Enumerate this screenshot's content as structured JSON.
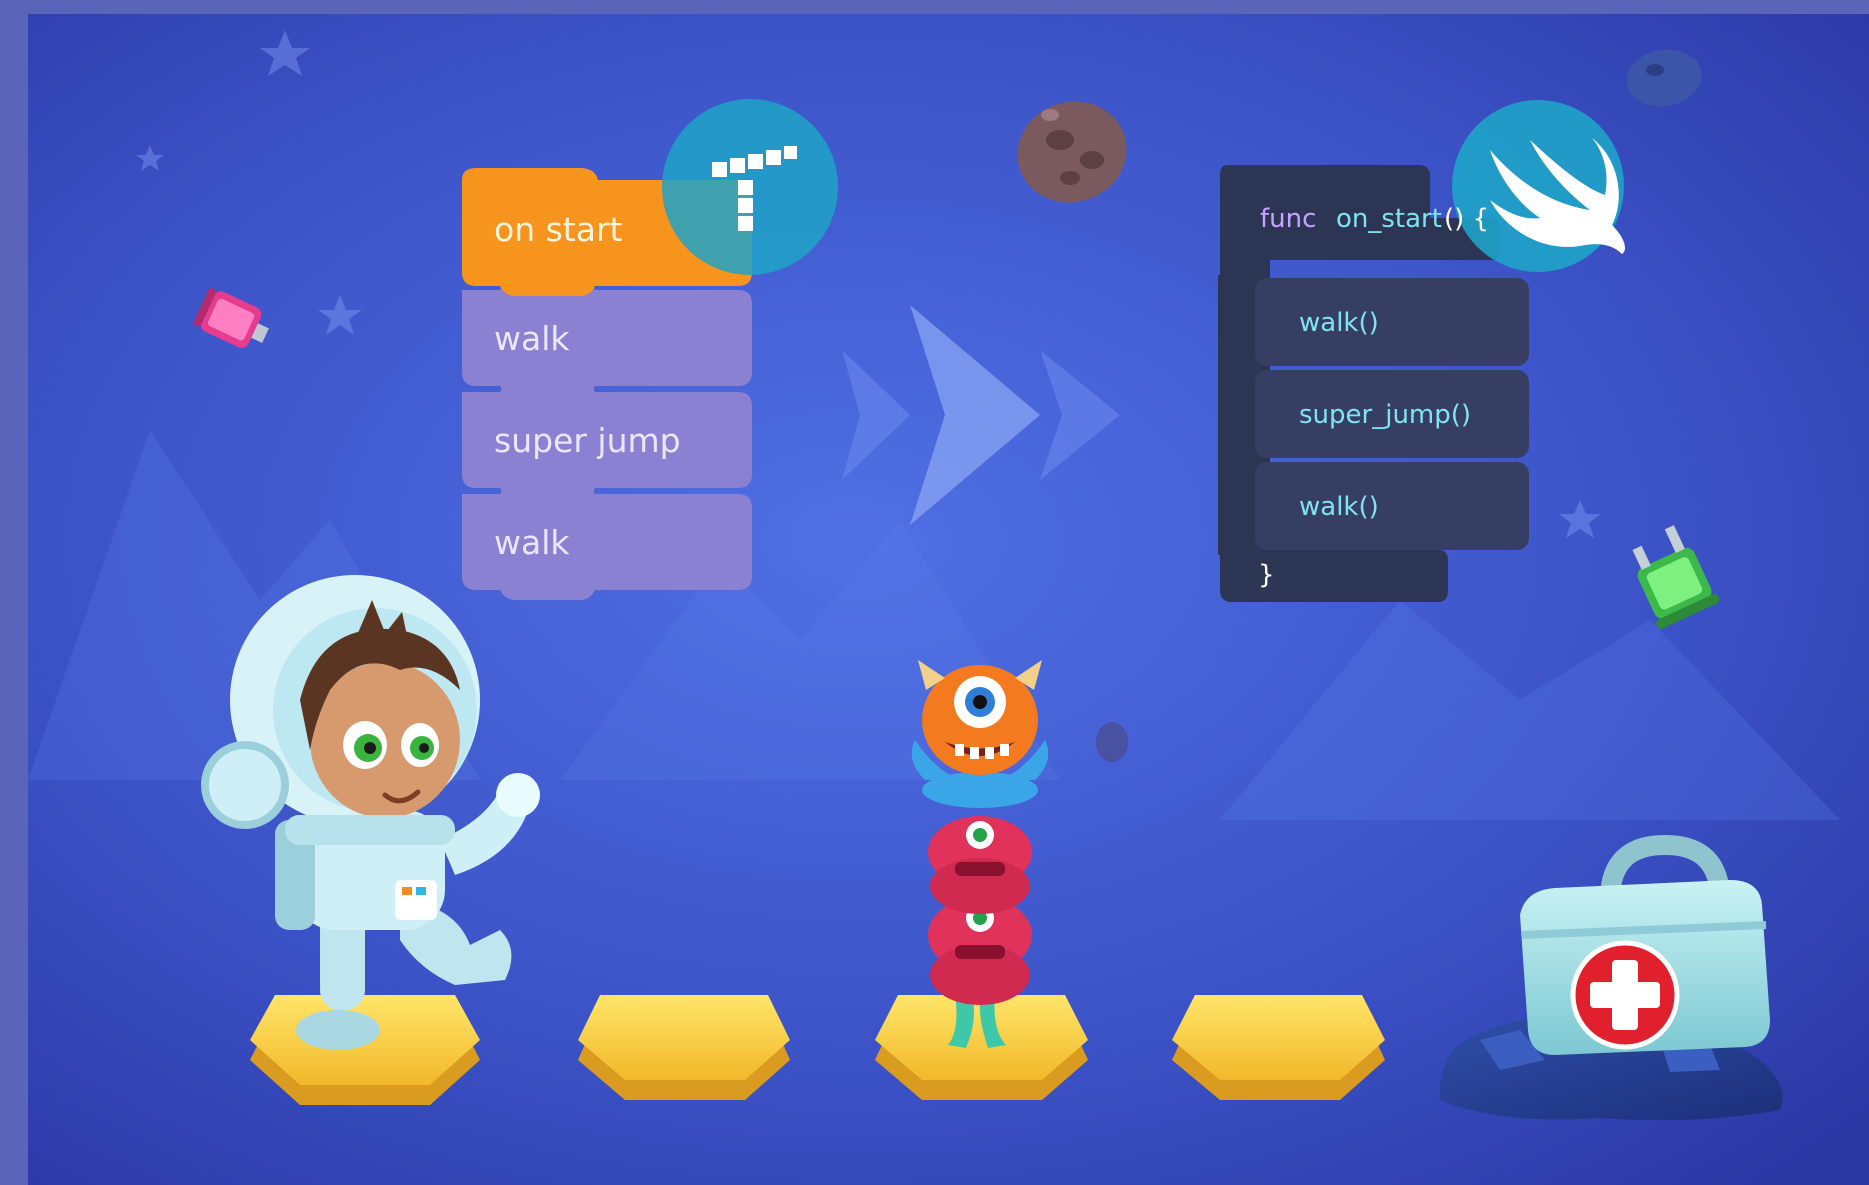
{
  "palette": {
    "sky_dark": "#2f3fb5",
    "sky_light": "#4d6be0",
    "frame": "#5a64b8",
    "event_block": "#f7941d",
    "action_block": "#8a7fd0",
    "code_block": "#2d3555",
    "code_block_light": "#363f63",
    "keyword": "#c7a3ff",
    "identifier": "#7fe3f0",
    "badge": "#1fa3c8",
    "hex_tile": "#f6c93a",
    "hex_tile_side": "#d99b20",
    "health_red": "#e0202c"
  },
  "visual_blocks": {
    "event": "on start",
    "actions": [
      "walk",
      "super jump",
      "walk"
    ]
  },
  "code_blocks": {
    "keyword": "func",
    "function_name": "on_start",
    "signature_end": "() {",
    "calls": [
      "walk()",
      "super_jump()",
      "walk()"
    ],
    "closing": "}"
  },
  "icons": {
    "block_language_badge": "t-block-logo-icon",
    "code_language_badge": "swift-logo-icon",
    "conversion_arrows": "chevron-right-icon"
  },
  "scene": {
    "tiles": 5,
    "hex_platforms": 4,
    "character": "astronaut-boy",
    "enemy": "stacked-monster",
    "goal": "first-aid-kit"
  }
}
